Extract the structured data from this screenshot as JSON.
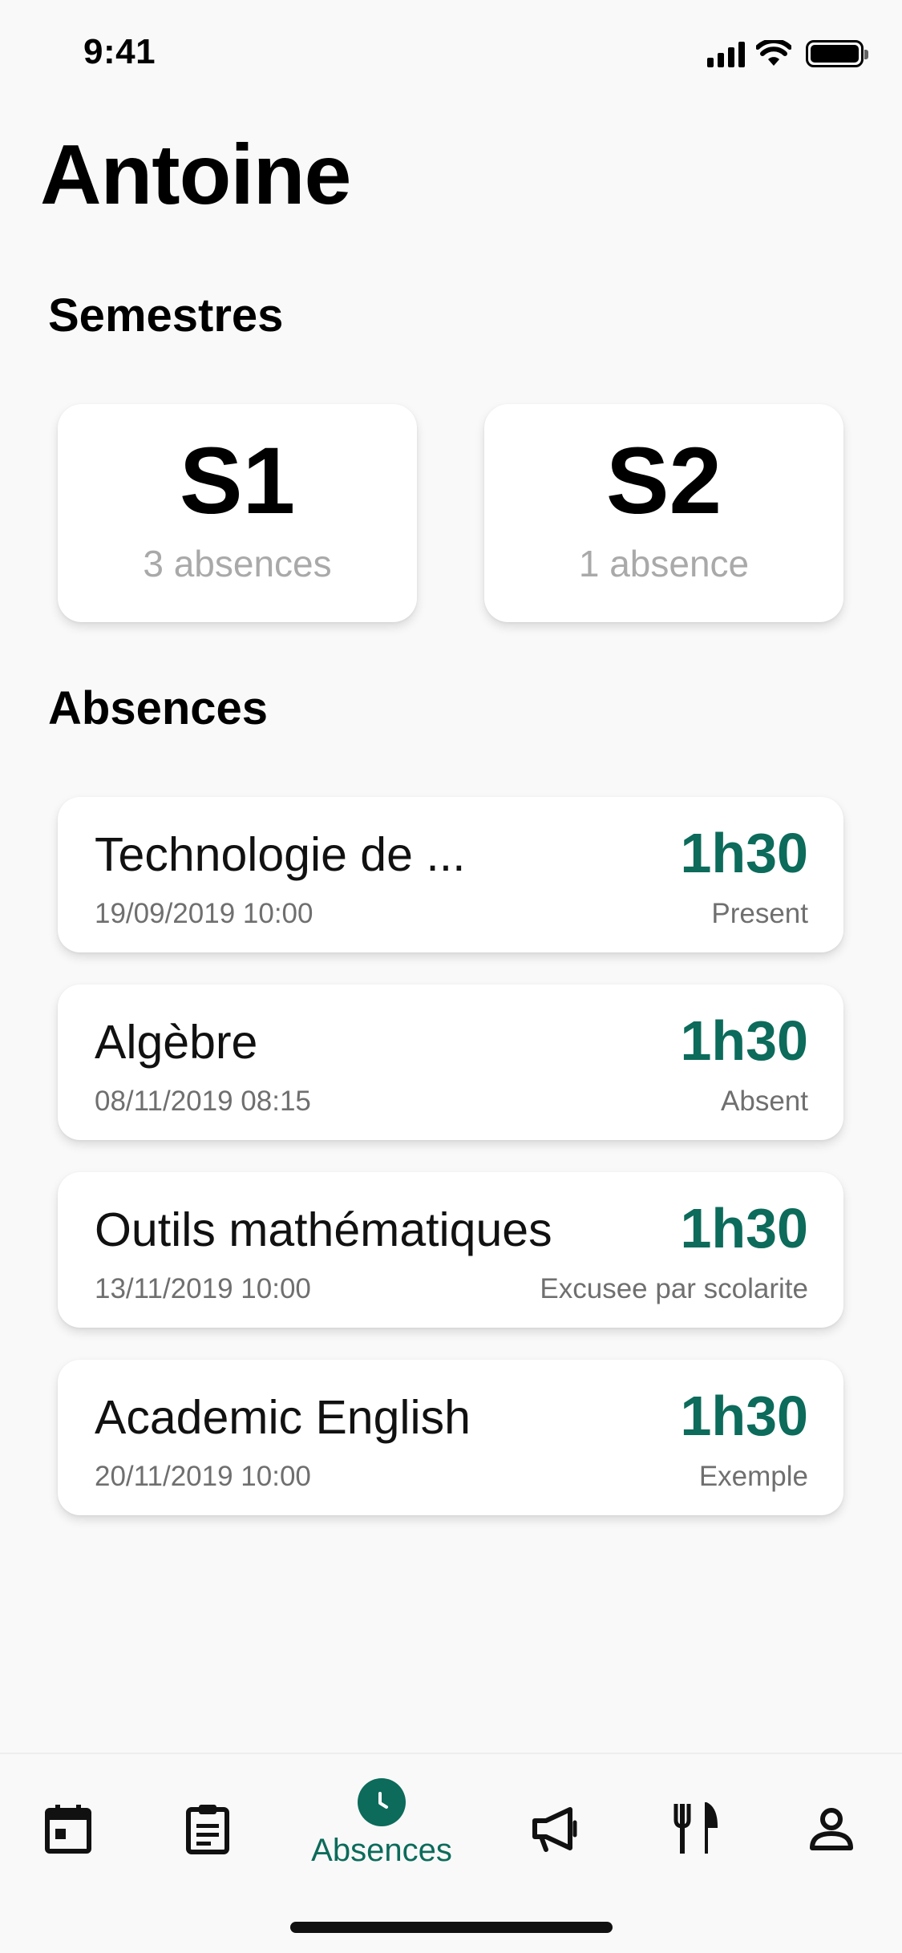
{
  "status_bar": {
    "time": "9:41"
  },
  "header": {
    "title": "Antoine"
  },
  "semesters_section": {
    "title": "Semestres",
    "items": [
      {
        "name": "S1",
        "count": "3 absences"
      },
      {
        "name": "S2",
        "count": "1 absence"
      }
    ]
  },
  "absences_section": {
    "title": "Absences",
    "items": [
      {
        "course": "Technologie de ...",
        "datetime": "19/09/2019 10:00",
        "duration": "1h30",
        "status": "Present"
      },
      {
        "course": "Algèbre",
        "datetime": "08/11/2019 08:15",
        "duration": "1h30",
        "status": "Absent"
      },
      {
        "course": "Outils mathématiques",
        "datetime": "13/11/2019 10:00",
        "duration": "1h30",
        "status": "Excusee par scolarite"
      },
      {
        "course": "Academic English",
        "datetime": "20/11/2019 10:00",
        "duration": "1h30",
        "status": "Exemple"
      }
    ]
  },
  "tab_bar": {
    "tabs": [
      {
        "icon": "calendar-icon"
      },
      {
        "icon": "clipboard-icon"
      },
      {
        "icon": "clock-icon",
        "label": "Absences",
        "active": true
      },
      {
        "icon": "megaphone-icon"
      },
      {
        "icon": "fork-knife-icon"
      },
      {
        "icon": "person-icon"
      }
    ]
  },
  "colors": {
    "accent": "#0c6b5b",
    "background": "#f9f9f9",
    "muted_text": "#6f6f6f"
  }
}
